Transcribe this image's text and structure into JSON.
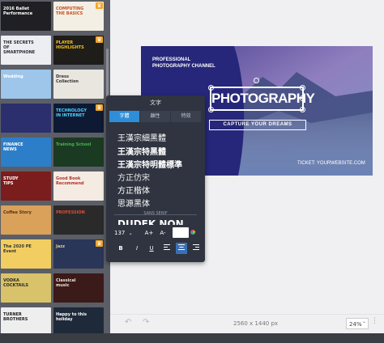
{
  "gallery": {
    "thumbs": [
      {
        "text": "2016 Ballet\nPerformance",
        "bg": "#1f1f24",
        "accent": "#ffffff",
        "premium": false
      },
      {
        "text": "COMPUTING\nTHE BASICS",
        "bg": "#f3efe4",
        "accent": "#c94f1e",
        "premium": true
      },
      {
        "text": "THE SECRETS OF\nSMARTPHONE",
        "bg": "#eceef2",
        "accent": "#2a2d36",
        "premium": false
      },
      {
        "text": "PLAYER\nHIGHLIGHTS",
        "bg": "#1f1d1a",
        "accent": "#f2c21a",
        "premium": true
      },
      {
        "text": "Wedding",
        "bg": "#9ec6ea",
        "accent": "#ffffff",
        "premium": false
      },
      {
        "text": "Dress\nCollection",
        "bg": "#e9e6e0",
        "accent": "#333333",
        "premium": false
      },
      {
        "text": "",
        "bg": "#2b2f6e",
        "accent": "#ffffff",
        "premium": false
      },
      {
        "text": "TECHNOLOGY IN INTERNET",
        "bg": "#0e1a33",
        "accent": "#4fd0ff",
        "premium": true
      },
      {
        "text": "FINANCE\nNEWS",
        "bg": "#2d7ec9",
        "accent": "#ffffff",
        "premium": false
      },
      {
        "text": "Training School",
        "bg": "#1b3a22",
        "accent": "#4caf50",
        "premium": false
      },
      {
        "text": "STUDY\nTIPS",
        "bg": "#7b1d1d",
        "accent": "#ffffff",
        "premium": false
      },
      {
        "text": "Good Book\nRecommend",
        "bg": "#f4ece2",
        "accent": "#b2302c",
        "premium": false
      },
      {
        "text": "Coffee Story",
        "bg": "#d9a15a",
        "accent": "#5a3212",
        "premium": false
      },
      {
        "text": "PROFESSION",
        "bg": "#2a2a2a",
        "accent": "#e04b3a",
        "premium": false
      },
      {
        "text": "The 2020 PE\nEvent",
        "bg": "#f2ce62",
        "accent": "#333333",
        "premium": false
      },
      {
        "text": "Jazz",
        "bg": "#2a3658",
        "accent": "#e8c87b",
        "premium": true
      },
      {
        "text": "VODKA\nCOCKTAILS",
        "bg": "#d8c36a",
        "accent": "#2a2a2a",
        "premium": false
      },
      {
        "text": "Classical\nmusic",
        "bg": "#3b1a1a",
        "accent": "#f0e6d2",
        "premium": false
      },
      {
        "text": "TURNER\nBROTHERS",
        "bg": "#eeeeee",
        "accent": "#222222",
        "premium": false
      },
      {
        "text": "Happy to this\nholiday",
        "bg": "#1e2a3a",
        "accent": "#ffffff",
        "premium": false
      }
    ]
  },
  "canvas": {
    "subtitle": "PROFESSIONAL\nPHOTOGRAPHY CHANNEL",
    "title": "PHOTOGRAPHY",
    "tagline": "CAPTURE YOUR DREAMS",
    "ticket": "TICKET: YOURWEBSITE.COM",
    "colors": {
      "left": "#2b2a73",
      "right": "#6a85b8",
      "sky": "#9b8cc0"
    }
  },
  "text_panel": {
    "header": "文字",
    "tabs": [
      {
        "label": "字體",
        "active": true
      },
      {
        "label": "離性",
        "active": false
      },
      {
        "label": "特效",
        "active": false
      }
    ],
    "fonts": [
      "王漢宗細黑體",
      "王漢宗特黑體",
      "王漢宗特明體標準",
      "方正仿宋",
      "方正楷体",
      "思源黑体"
    ],
    "section_label": "SANS SERIF",
    "next_font": "DUDEK NON",
    "font_size": "137",
    "size_increase": "A+",
    "size_decrease": "A-",
    "color": "#ffffff",
    "style_buttons": {
      "bold": "B",
      "italic": "I",
      "underline": "U"
    },
    "active_align": "center"
  },
  "bottom_bar": {
    "undo_icon": "undo-icon",
    "redo_icon": "redo-icon",
    "dimensions": "2560 x 1440 px",
    "zoom": "24%"
  }
}
